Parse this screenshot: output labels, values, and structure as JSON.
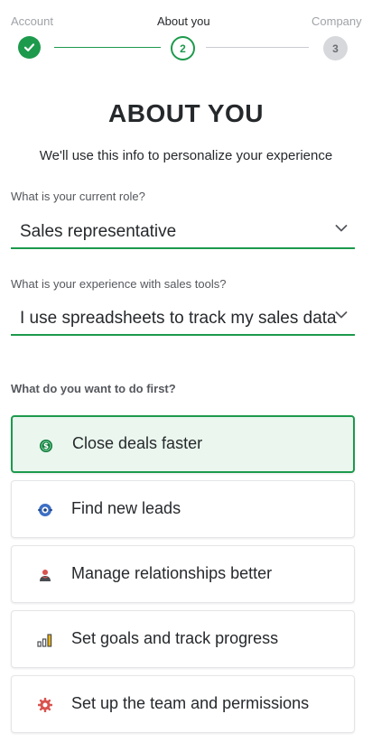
{
  "stepper": {
    "steps": [
      {
        "label": "Account",
        "status": "done"
      },
      {
        "label": "About you",
        "status": "current",
        "number": "2"
      },
      {
        "label": "Company",
        "status": "todo",
        "number": "3"
      }
    ]
  },
  "page": {
    "title": "ABOUT YOU",
    "subtitle": "We'll use this info to personalize your experience"
  },
  "form": {
    "role": {
      "label": "What is your current role?",
      "value": "Sales representative"
    },
    "experience": {
      "label": "What is your experience with sales tools?",
      "value": "I use spreadsheets to track my sales data"
    },
    "goals": {
      "label": "What do you want to do first?",
      "options": [
        {
          "label": "Close deals faster",
          "icon": "dollar-coin-icon",
          "selected": true
        },
        {
          "label": "Find new leads",
          "icon": "target-icon",
          "selected": false
        },
        {
          "label": "Manage relationships better",
          "icon": "person-icon",
          "selected": false
        },
        {
          "label": "Set goals and track progress",
          "icon": "bar-chart-icon",
          "selected": false
        },
        {
          "label": "Set up the team and permissions",
          "icon": "gear-icon",
          "selected": false
        }
      ]
    }
  },
  "colors": {
    "accent": "#1d9a4c",
    "selected_bg": "#eaf6ee",
    "text": "#26292c",
    "muted": "#a0a3a8"
  }
}
